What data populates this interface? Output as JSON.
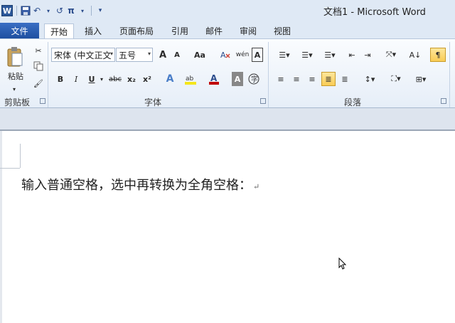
{
  "window": {
    "title": "文档1 - Microsoft Word"
  },
  "qat": {
    "logo": "W",
    "save_icon": "💾",
    "undo_icon": "↶",
    "redo_icon": "↺",
    "pi": "π",
    "more": "▾"
  },
  "tabs": [
    {
      "label": "文件"
    },
    {
      "label": "开始"
    },
    {
      "label": "插入"
    },
    {
      "label": "页面布局"
    },
    {
      "label": "引用"
    },
    {
      "label": "邮件"
    },
    {
      "label": "审阅"
    },
    {
      "label": "视图"
    }
  ],
  "clipboard": {
    "paste_label": "粘贴",
    "group_label": "剪贴板"
  },
  "font": {
    "name": "宋体 (中文正文",
    "size": "五号",
    "group_label": "字体",
    "bold": "B",
    "italic": "I",
    "underline": "U",
    "strike": "abc",
    "subscript": "x₂",
    "superscript": "x²",
    "grow": "A",
    "shrink": "A",
    "case": "Aa",
    "clear": "A"
  },
  "paragraph": {
    "group_label": "段落"
  },
  "document": {
    "text": "输入普通空格，选中再转换为全角空格：",
    "para_mark": "↵"
  },
  "colors": {
    "accent": "#2b579a",
    "highlight": "#f9cc55",
    "font_color": "#c00000"
  }
}
